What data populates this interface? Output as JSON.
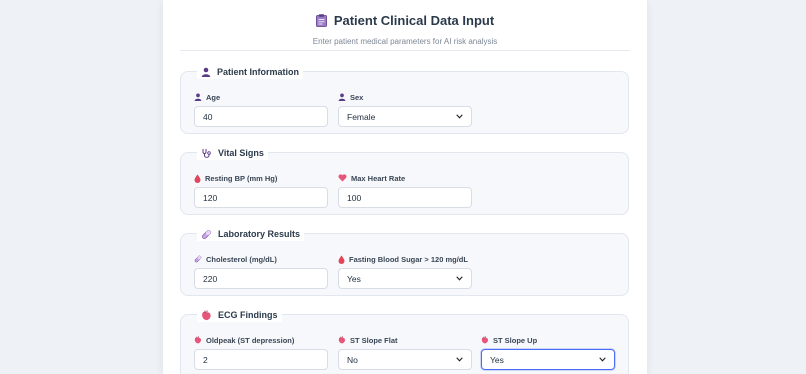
{
  "header": {
    "title": "Patient Clinical Data Input",
    "subtitle": "Enter patient medical parameters for AI risk analysis",
    "icon": "clipboard-icon"
  },
  "sections": {
    "patient_info": {
      "title": "Patient Information",
      "icon": "person-icon",
      "age": {
        "label": "Age",
        "value": "40",
        "icon": "person-icon"
      },
      "sex": {
        "label": "Sex",
        "value": "Female",
        "icon": "person-icon"
      }
    },
    "vital_signs": {
      "title": "Vital Signs",
      "icon": "stethoscope-icon",
      "resting_bp": {
        "label": "Resting BP (mm Hg)",
        "value": "120",
        "icon": "blood-drop-icon"
      },
      "max_heart_rate": {
        "label": "Max Heart Rate",
        "value": "100",
        "icon": "heart-icon"
      }
    },
    "lab_results": {
      "title": "Laboratory Results",
      "icon": "pill-icon",
      "cholesterol": {
        "label": "Cholesterol (mg/dL)",
        "value": "220",
        "icon": "pill-icon"
      },
      "fasting_blood_sugar": {
        "label": "Fasting Blood Sugar > 120 mg/dL",
        "value": "Yes",
        "icon": "blood-drop-icon"
      }
    },
    "ecg": {
      "title": "ECG Findings",
      "icon": "anatomical-heart-icon",
      "oldpeak": {
        "label": "Oldpeak (ST depression)",
        "value": "2",
        "icon": "anatomical-heart-icon"
      },
      "st_slope_flat": {
        "label": "ST Slope Flat",
        "value": "No",
        "icon": "anatomical-heart-icon"
      },
      "st_slope_up": {
        "label": "ST Slope Up",
        "value": "Yes",
        "icon": "anatomical-heart-icon"
      }
    }
  },
  "colors": {
    "accent": "#4a6cf7",
    "icon_purple": "#5b3b86",
    "icon_red": "#e0455a",
    "icon_pink": "#e7557b"
  }
}
